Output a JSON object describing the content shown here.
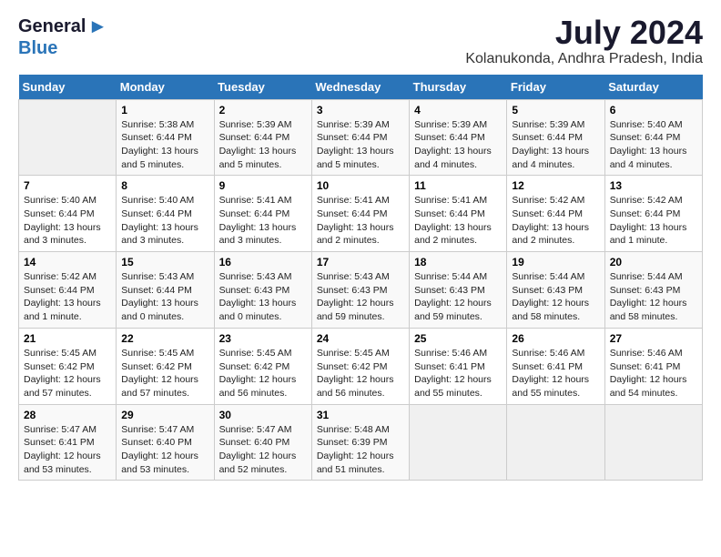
{
  "app": {
    "logo_part1": "General",
    "logo_part2": "Blue",
    "main_title": "July 2024",
    "subtitle": "Kolanukonda, Andhra Pradesh, India"
  },
  "calendar": {
    "headers": [
      "Sunday",
      "Monday",
      "Tuesday",
      "Wednesday",
      "Thursday",
      "Friday",
      "Saturday"
    ],
    "rows": [
      [
        {
          "day": "",
          "sunrise": "",
          "sunset": "",
          "daylight": "",
          "empty": true
        },
        {
          "day": "1",
          "sunrise": "Sunrise: 5:38 AM",
          "sunset": "Sunset: 6:44 PM",
          "daylight": "Daylight: 13 hours and 5 minutes."
        },
        {
          "day": "2",
          "sunrise": "Sunrise: 5:39 AM",
          "sunset": "Sunset: 6:44 PM",
          "daylight": "Daylight: 13 hours and 5 minutes."
        },
        {
          "day": "3",
          "sunrise": "Sunrise: 5:39 AM",
          "sunset": "Sunset: 6:44 PM",
          "daylight": "Daylight: 13 hours and 5 minutes."
        },
        {
          "day": "4",
          "sunrise": "Sunrise: 5:39 AM",
          "sunset": "Sunset: 6:44 PM",
          "daylight": "Daylight: 13 hours and 4 minutes."
        },
        {
          "day": "5",
          "sunrise": "Sunrise: 5:39 AM",
          "sunset": "Sunset: 6:44 PM",
          "daylight": "Daylight: 13 hours and 4 minutes."
        },
        {
          "day": "6",
          "sunrise": "Sunrise: 5:40 AM",
          "sunset": "Sunset: 6:44 PM",
          "daylight": "Daylight: 13 hours and 4 minutes."
        }
      ],
      [
        {
          "day": "7",
          "sunrise": "Sunrise: 5:40 AM",
          "sunset": "Sunset: 6:44 PM",
          "daylight": "Daylight: 13 hours and 3 minutes."
        },
        {
          "day": "8",
          "sunrise": "Sunrise: 5:40 AM",
          "sunset": "Sunset: 6:44 PM",
          "daylight": "Daylight: 13 hours and 3 minutes."
        },
        {
          "day": "9",
          "sunrise": "Sunrise: 5:41 AM",
          "sunset": "Sunset: 6:44 PM",
          "daylight": "Daylight: 13 hours and 3 minutes."
        },
        {
          "day": "10",
          "sunrise": "Sunrise: 5:41 AM",
          "sunset": "Sunset: 6:44 PM",
          "daylight": "Daylight: 13 hours and 2 minutes."
        },
        {
          "day": "11",
          "sunrise": "Sunrise: 5:41 AM",
          "sunset": "Sunset: 6:44 PM",
          "daylight": "Daylight: 13 hours and 2 minutes."
        },
        {
          "day": "12",
          "sunrise": "Sunrise: 5:42 AM",
          "sunset": "Sunset: 6:44 PM",
          "daylight": "Daylight: 13 hours and 2 minutes."
        },
        {
          "day": "13",
          "sunrise": "Sunrise: 5:42 AM",
          "sunset": "Sunset: 6:44 PM",
          "daylight": "Daylight: 13 hours and 1 minute."
        }
      ],
      [
        {
          "day": "14",
          "sunrise": "Sunrise: 5:42 AM",
          "sunset": "Sunset: 6:44 PM",
          "daylight": "Daylight: 13 hours and 1 minute."
        },
        {
          "day": "15",
          "sunrise": "Sunrise: 5:43 AM",
          "sunset": "Sunset: 6:44 PM",
          "daylight": "Daylight: 13 hours and 0 minutes."
        },
        {
          "day": "16",
          "sunrise": "Sunrise: 5:43 AM",
          "sunset": "Sunset: 6:43 PM",
          "daylight": "Daylight: 13 hours and 0 minutes."
        },
        {
          "day": "17",
          "sunrise": "Sunrise: 5:43 AM",
          "sunset": "Sunset: 6:43 PM",
          "daylight": "Daylight: 12 hours and 59 minutes."
        },
        {
          "day": "18",
          "sunrise": "Sunrise: 5:44 AM",
          "sunset": "Sunset: 6:43 PM",
          "daylight": "Daylight: 12 hours and 59 minutes."
        },
        {
          "day": "19",
          "sunrise": "Sunrise: 5:44 AM",
          "sunset": "Sunset: 6:43 PM",
          "daylight": "Daylight: 12 hours and 58 minutes."
        },
        {
          "day": "20",
          "sunrise": "Sunrise: 5:44 AM",
          "sunset": "Sunset: 6:43 PM",
          "daylight": "Daylight: 12 hours and 58 minutes."
        }
      ],
      [
        {
          "day": "21",
          "sunrise": "Sunrise: 5:45 AM",
          "sunset": "Sunset: 6:42 PM",
          "daylight": "Daylight: 12 hours and 57 minutes."
        },
        {
          "day": "22",
          "sunrise": "Sunrise: 5:45 AM",
          "sunset": "Sunset: 6:42 PM",
          "daylight": "Daylight: 12 hours and 57 minutes."
        },
        {
          "day": "23",
          "sunrise": "Sunrise: 5:45 AM",
          "sunset": "Sunset: 6:42 PM",
          "daylight": "Daylight: 12 hours and 56 minutes."
        },
        {
          "day": "24",
          "sunrise": "Sunrise: 5:45 AM",
          "sunset": "Sunset: 6:42 PM",
          "daylight": "Daylight: 12 hours and 56 minutes."
        },
        {
          "day": "25",
          "sunrise": "Sunrise: 5:46 AM",
          "sunset": "Sunset: 6:41 PM",
          "daylight": "Daylight: 12 hours and 55 minutes."
        },
        {
          "day": "26",
          "sunrise": "Sunrise: 5:46 AM",
          "sunset": "Sunset: 6:41 PM",
          "daylight": "Daylight: 12 hours and 55 minutes."
        },
        {
          "day": "27",
          "sunrise": "Sunrise: 5:46 AM",
          "sunset": "Sunset: 6:41 PM",
          "daylight": "Daylight: 12 hours and 54 minutes."
        }
      ],
      [
        {
          "day": "28",
          "sunrise": "Sunrise: 5:47 AM",
          "sunset": "Sunset: 6:41 PM",
          "daylight": "Daylight: 12 hours and 53 minutes."
        },
        {
          "day": "29",
          "sunrise": "Sunrise: 5:47 AM",
          "sunset": "Sunset: 6:40 PM",
          "daylight": "Daylight: 12 hours and 53 minutes."
        },
        {
          "day": "30",
          "sunrise": "Sunrise: 5:47 AM",
          "sunset": "Sunset: 6:40 PM",
          "daylight": "Daylight: 12 hours and 52 minutes."
        },
        {
          "day": "31",
          "sunrise": "Sunrise: 5:48 AM",
          "sunset": "Sunset: 6:39 PM",
          "daylight": "Daylight: 12 hours and 51 minutes."
        },
        {
          "day": "",
          "sunrise": "",
          "sunset": "",
          "daylight": "",
          "empty": true
        },
        {
          "day": "",
          "sunrise": "",
          "sunset": "",
          "daylight": "",
          "empty": true
        },
        {
          "day": "",
          "sunrise": "",
          "sunset": "",
          "daylight": "",
          "empty": true
        }
      ]
    ]
  }
}
